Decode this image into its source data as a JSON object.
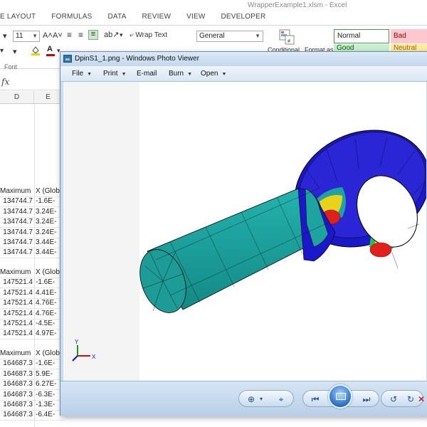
{
  "excel": {
    "window_title": "WrapperExample1.xlsm - Excel",
    "ribbon_tabs": [
      "E LAYOUT",
      "FORMULAS",
      "DATA",
      "REVIEW",
      "VIEW",
      "DEVELOPER"
    ],
    "font_size": "11",
    "wrap_text_label": "Wrap Text",
    "number_format": "General",
    "conditional_label": "Conditional",
    "format_as_label": "Format as",
    "styles": {
      "normal": "Normal",
      "bad": "Bad",
      "good": "Good",
      "neutral": "Neutral"
    },
    "group_font_label": "Font",
    "fx_label": "fx",
    "column_headers": [
      "D",
      "E"
    ],
    "blocks": [
      {
        "header": [
          "Maximum",
          "X (Glob"
        ],
        "rows": [
          [
            "134744.7",
            "-1.6E-"
          ],
          [
            "134744.7",
            "3.24E-"
          ],
          [
            "134744.7",
            "3.24E-"
          ],
          [
            "134744.7",
            "3.24E-"
          ],
          [
            "134744.7",
            "3.44E-"
          ],
          [
            "134744.7",
            "3.44E-"
          ]
        ]
      },
      {
        "header": [
          "Maximum",
          "X (Glob"
        ],
        "rows": [
          [
            "147521.4",
            "-1.6E-"
          ],
          [
            "147521.4",
            "4.41E-"
          ],
          [
            "147521.4",
            "4.76E-"
          ],
          [
            "147521.4",
            "4.76E-"
          ],
          [
            "147521.4",
            "-4.5E-"
          ],
          [
            "147521.4",
            "4.97E-"
          ]
        ]
      },
      {
        "header": [
          "Maximum",
          "X (Glob"
        ],
        "rows": [
          [
            "164687.3",
            "-1.6E-"
          ],
          [
            "164687.3",
            "5.9E-"
          ],
          [
            "164687.3",
            "6.27E-"
          ],
          [
            "164687.3",
            "-6.3E-"
          ],
          [
            "164687.3",
            "-1.3E-"
          ],
          [
            "164687.3",
            "-6.4E-"
          ]
        ]
      }
    ]
  },
  "photo_viewer": {
    "title": "DpinS1_1.png - Windows Photo Viewer",
    "menus": [
      "File",
      "Print",
      "E-mail",
      "Burn",
      "Open"
    ],
    "axis_labels": {
      "x": "X",
      "y": "Y"
    },
    "colors": {
      "teal": "#1fa3a0",
      "blue": "#1010c8",
      "red": "#e0201a",
      "yellow": "#e8d21a",
      "green": "#27c24a"
    }
  }
}
